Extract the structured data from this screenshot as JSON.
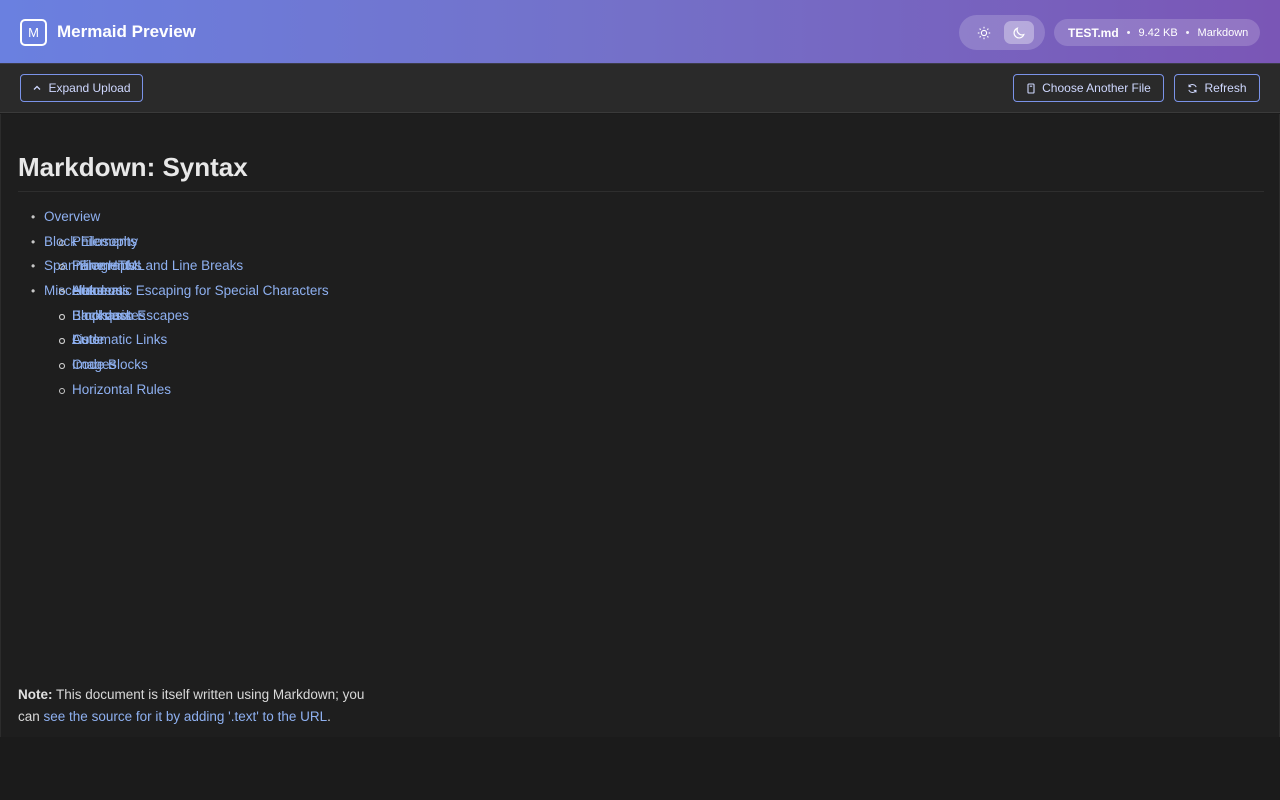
{
  "app": {
    "logo_letter": "M",
    "title": "Mermaid Preview"
  },
  "theme": {
    "light_icon": "sun-icon",
    "dark_icon": "moon-icon",
    "active": "dark"
  },
  "file_info": {
    "name": "TEST.md",
    "size": "9.42 KB",
    "type": "Markdown",
    "separator": "•"
  },
  "toolbar": {
    "expand_label": "Expand Upload",
    "choose_label": "Choose Another File",
    "refresh_label": "Refresh"
  },
  "colors": {
    "accent": "#7b93e8",
    "link": "#8eb0f0",
    "header_start": "#6a80e0",
    "header_end": "#7a56b6"
  },
  "document": {
    "title": "Markdown: Syntax",
    "toc": [
      {
        "label": "Overview",
        "children": [
          "Philosophy",
          "Inline HTML",
          "Automatic Escaping for Special Characters"
        ]
      },
      {
        "label": "Block Elements",
        "children": [
          "Paragraphs and Line Breaks",
          "Headers",
          "Blockquotes",
          "Lists",
          "Code Blocks",
          "Horizontal Rules"
        ]
      },
      {
        "label": "Span Elements",
        "children": [
          "Links",
          "Emphasis",
          "Code",
          "Images"
        ]
      },
      {
        "label": "Miscellaneous",
        "children": [
          "Backslash Escapes",
          "Automatic Links"
        ]
      }
    ],
    "note": {
      "label": "Note:",
      "text": " This document is itself written using Markdown; you can ",
      "link": "see the source for it by adding '.text' to the URL",
      "end": "."
    }
  }
}
